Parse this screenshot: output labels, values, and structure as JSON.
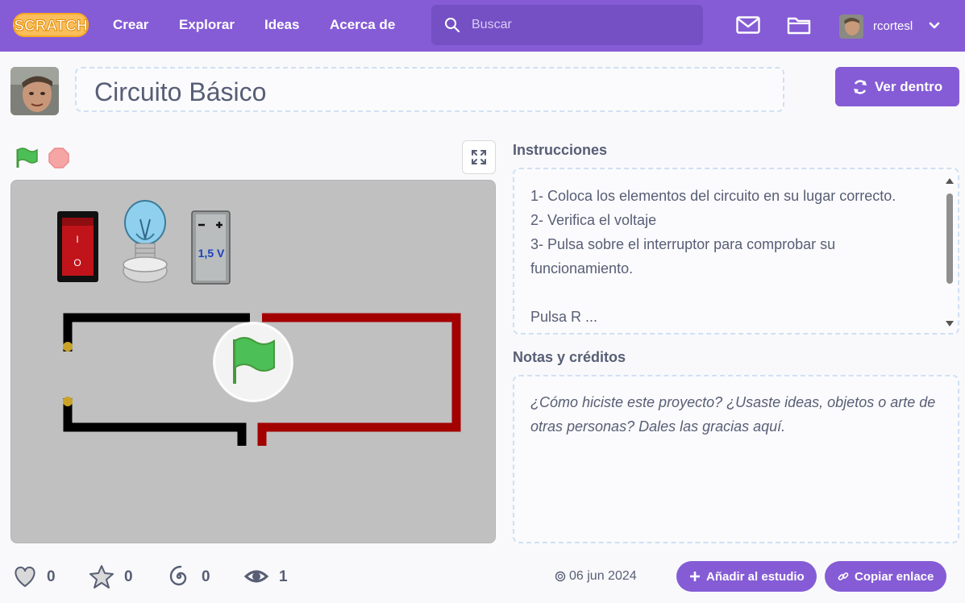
{
  "nav": {
    "logo_text": "SCRATCH",
    "links": [
      "Crear",
      "Explorar",
      "Ideas",
      "Acerca de"
    ],
    "search_placeholder": "Buscar",
    "username": "rcortesl"
  },
  "project": {
    "title": "Circuito Básico",
    "see_inside": "Ver dentro"
  },
  "stage": {
    "battery_label": "1,5 V",
    "switch_on_label": "I",
    "switch_off_label": "O"
  },
  "instructions": {
    "heading": "Instrucciones",
    "lines": [
      "1- Coloca los elementos del circuito en su lugar correcto.",
      "2- Verifica el voltaje",
      "3- Pulsa sobre el interruptor para comprobar su funcionamiento.",
      "",
      "Pulsa R ... "
    ]
  },
  "notes": {
    "heading": "Notas y créditos",
    "placeholder": "¿Cómo hiciste este proyecto? ¿Usaste ideas, objetos o arte de otras personas? Dales las gracias aquí."
  },
  "stats": {
    "loves": "0",
    "favorites": "0",
    "remixes": "0",
    "views": "1",
    "date": "06 jun 2024"
  },
  "actions": {
    "add_to_studio": "Añadir al estudio",
    "copy_link": "Copiar enlace"
  },
  "colors": {
    "brand": "#855cd6",
    "search_bg": "#7550c4",
    "text": "#575e75",
    "wire_red": "#a30000",
    "wire_black": "#000000",
    "green_flag": "#4cbf56"
  },
  "icons": [
    "search-icon",
    "mail-icon",
    "folder-icon",
    "chevron-down-icon",
    "remix-icon",
    "green-flag-icon",
    "stop-icon",
    "fullscreen-icon",
    "heart-icon",
    "star-icon",
    "spiral-icon",
    "eye-icon",
    "plus-icon",
    "link-icon"
  ]
}
